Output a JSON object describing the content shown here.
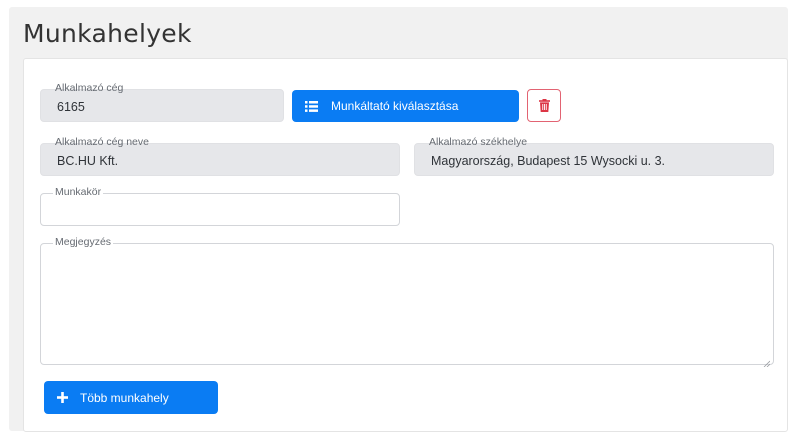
{
  "section": {
    "title": "Munkahelyek"
  },
  "employer": {
    "id_label": "Alkalmazó cég",
    "id_value": "6165",
    "select_button_label": "Munkáltató kiválasztása",
    "select_button_icon": "list-icon",
    "delete_button_icon": "trash-icon",
    "name_label": "Alkalmazó cég neve",
    "name_value": "BC.HU Kft.",
    "address_label": "Alkalmazó székhelye",
    "address_value": "Magyarország, Budapest  15 Wysocki u. 3."
  },
  "job": {
    "position_label": "Munkakör",
    "position_value": "",
    "note_label": "Megjegyzés",
    "note_value": ""
  },
  "actions": {
    "add_more_label": "Több munkahely",
    "add_more_icon": "plus-icon"
  },
  "colors": {
    "primary": "#0a7cf3",
    "danger": "#dc3545",
    "readonly_bg": "#e6e7ea",
    "panel_bg": "#f1f1f1"
  }
}
